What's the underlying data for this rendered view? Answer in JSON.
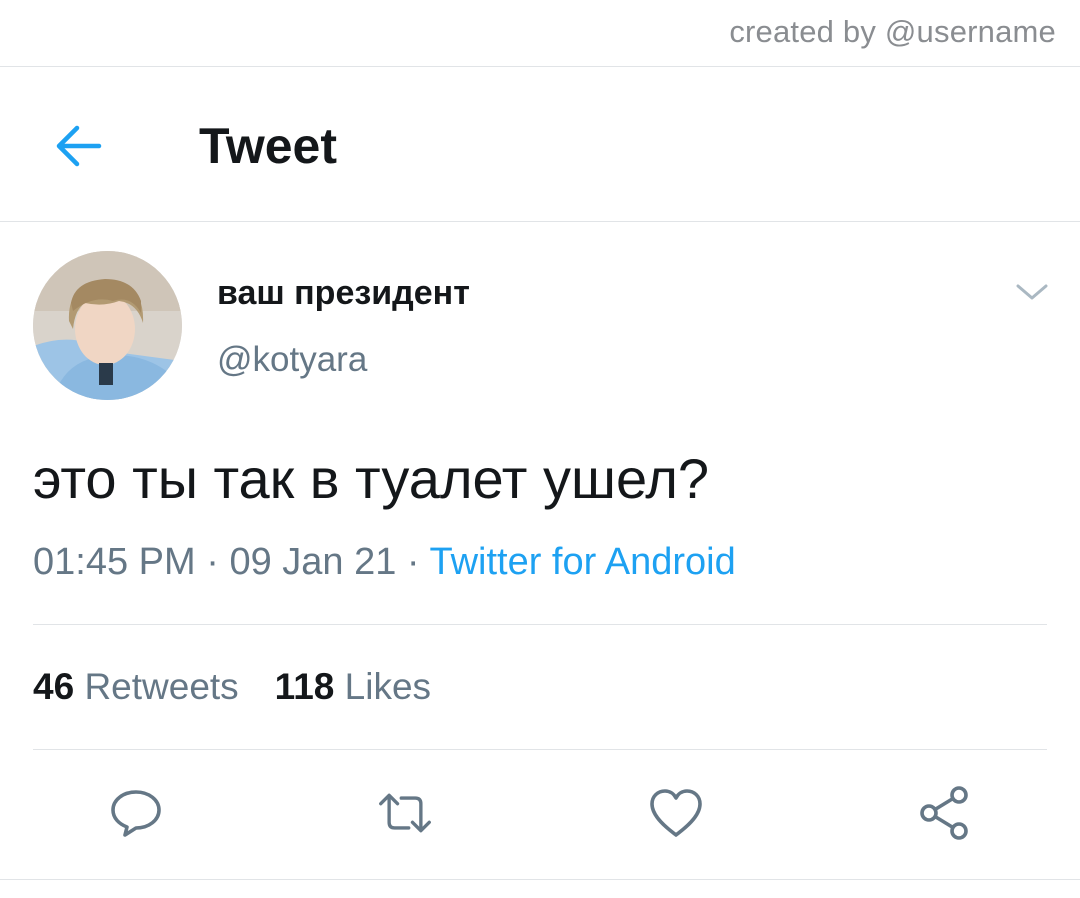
{
  "watermark": "created by @username",
  "header": {
    "back_icon": "arrow-left-icon",
    "title": "Tweet"
  },
  "tweet": {
    "author": {
      "display_name": "ваш президент",
      "handle": "@kotyara",
      "avatar": "avatar-photo"
    },
    "more_icon": "chevron-down-icon",
    "text": "это ты так в туалет ушел?",
    "time": "01:45 PM",
    "separator": "·",
    "date": "09 Jan 21",
    "source": "Twitter for Android",
    "stats": {
      "retweets_count": "46",
      "retweets_label": "Retweets",
      "likes_count": "118",
      "likes_label": "Likes"
    },
    "actions": [
      {
        "name": "reply",
        "icon": "reply-icon"
      },
      {
        "name": "retweet",
        "icon": "retweet-icon"
      },
      {
        "name": "like",
        "icon": "heart-icon"
      },
      {
        "name": "share",
        "icon": "share-icon"
      }
    ]
  },
  "colors": {
    "accent": "#1da1f2",
    "text_primary": "#14171a",
    "text_secondary": "#657786",
    "divider": "#e1e4e7",
    "icon_gray": "#657786"
  }
}
